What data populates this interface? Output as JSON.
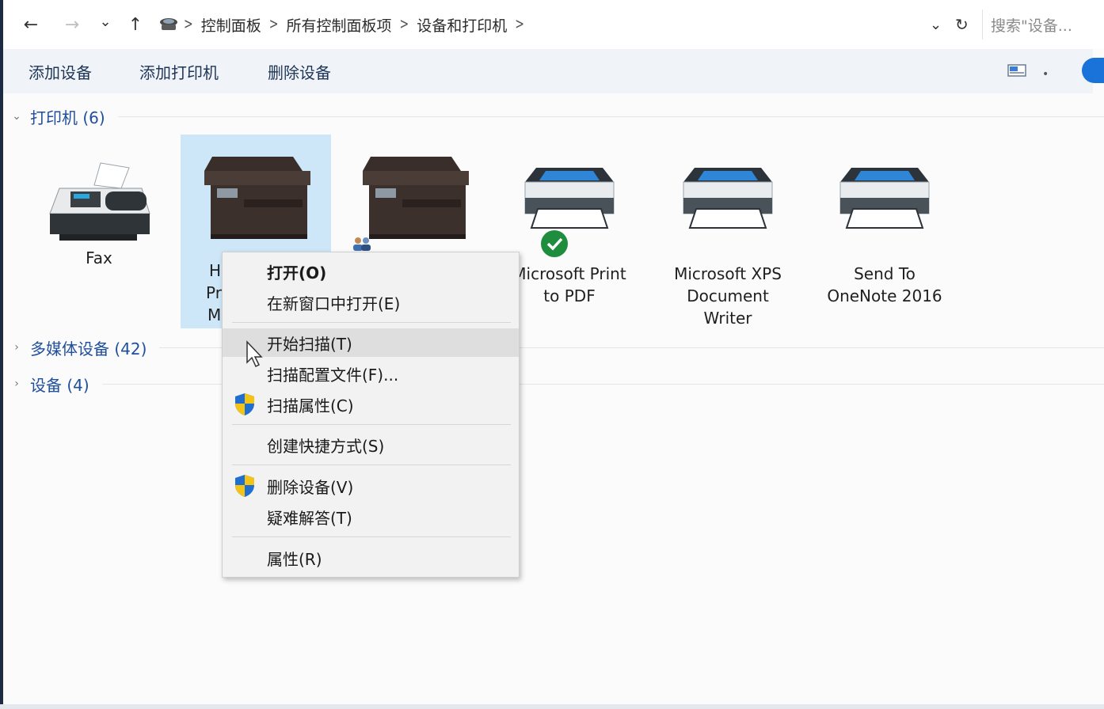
{
  "addressbar": {
    "back": "←",
    "forward": "→",
    "recent": "⌄",
    "up": "↑",
    "breadcrumbs": [
      "控制面板",
      "所有控制面板项",
      "设备和打印机"
    ],
    "dropdown": "⌄",
    "refresh": "↻",
    "search_placeholder": "搜索\"设备..."
  },
  "toolbar": {
    "add_device": "添加设备",
    "add_printer": "添加打印机",
    "remove_device": "删除设备"
  },
  "groups": {
    "printers": "打印机 (6)",
    "multimedia": "多媒体设备 (42)",
    "devices": "设备 (4)"
  },
  "devices": [
    {
      "line1": "Fax",
      "line2": "",
      "line3": ""
    },
    {
      "line1": "H",
      "line2": "Pr",
      "line3": "M"
    },
    {
      "line1": "",
      "line2": "",
      "line3": ""
    },
    {
      "line1": "Microsoft Print",
      "line2": "to PDF",
      "line3": ""
    },
    {
      "line1": "Microsoft XPS",
      "line2": "Document",
      "line3": "Writer"
    },
    {
      "line1": "Send To",
      "line2": "OneNote 2016",
      "line3": ""
    }
  ],
  "context_menu": {
    "open": "打开(O)",
    "open_new_window": "在新窗口中打开(E)",
    "start_scan": "开始扫描(T)",
    "scan_profiles": "扫描配置文件(F)...",
    "scan_properties": "扫描属性(C)",
    "create_shortcut": "创建快捷方式(S)",
    "remove_device": "删除设备(V)",
    "troubleshoot": "疑难解答(T)",
    "properties": "属性(R)"
  },
  "colors": {
    "accent": "#1f4f9c",
    "selection": "#cde6f8",
    "menu_bg": "#f2f2f2",
    "menu_hover": "#dedede",
    "default_check": "#1e8e3e"
  }
}
